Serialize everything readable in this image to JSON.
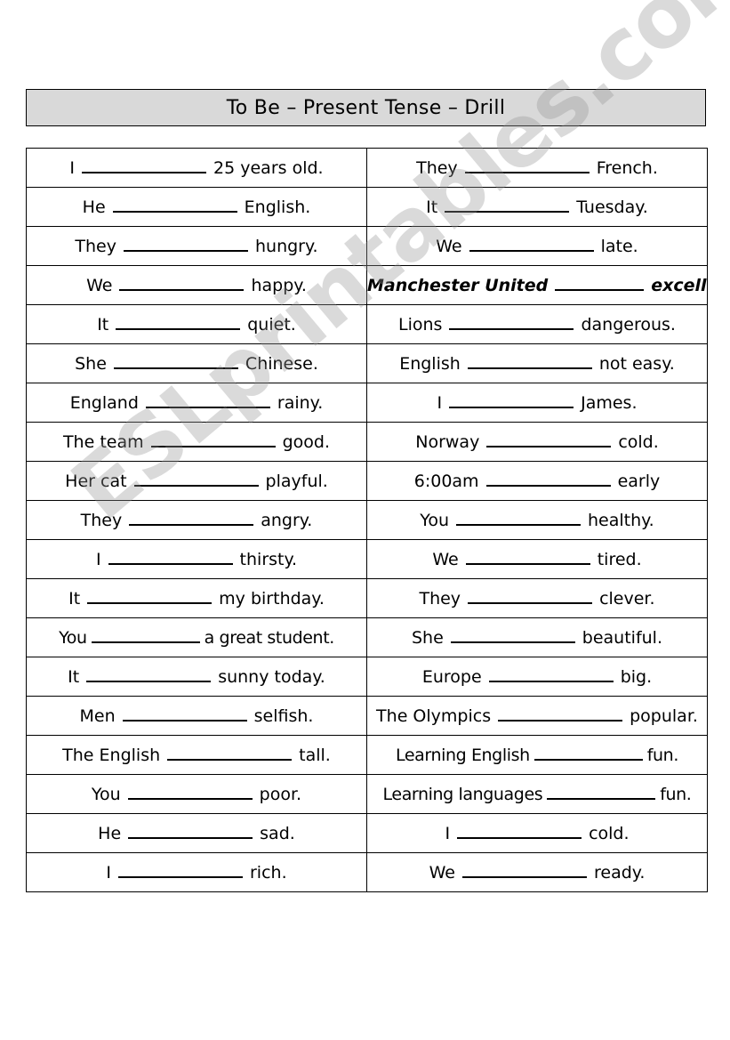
{
  "title": "To Be – Present Tense – Drill",
  "watermark": "ESLprintables.com",
  "rows": [
    {
      "left": {
        "subject": "I",
        "complement": "25 years old."
      },
      "right": {
        "subject": "They",
        "complement": "French."
      }
    },
    {
      "left": {
        "subject": "He",
        "complement": "English."
      },
      "right": {
        "subject": "It",
        "complement": "Tuesday."
      }
    },
    {
      "left": {
        "subject": "They",
        "complement": "hungry."
      },
      "right": {
        "subject": "We",
        "complement": "late."
      }
    },
    {
      "left": {
        "subject": "We",
        "complement": "happy."
      },
      "right": {
        "subject": "Manchester United",
        "complement": "excellent."
      }
    },
    {
      "left": {
        "subject": "It",
        "complement": "quiet."
      },
      "right": {
        "subject": "Lions",
        "complement": "dangerous."
      }
    },
    {
      "left": {
        "subject": "She",
        "complement": "Chinese."
      },
      "right": {
        "subject": "English",
        "complement": "not easy."
      }
    },
    {
      "left": {
        "subject": "England",
        "complement": "rainy."
      },
      "right": {
        "subject": "I",
        "complement": "James."
      }
    },
    {
      "left": {
        "subject": "The team",
        "complement": "good."
      },
      "right": {
        "subject": "Norway",
        "complement": "cold."
      }
    },
    {
      "left": {
        "subject": "Her cat",
        "complement": "playful."
      },
      "right": {
        "subject": "6:00am",
        "complement": "early"
      }
    },
    {
      "left": {
        "subject": "They",
        "complement": "angry."
      },
      "right": {
        "subject": "You",
        "complement": "healthy."
      }
    },
    {
      "left": {
        "subject": "I",
        "complement": "thirsty."
      },
      "right": {
        "subject": "We",
        "complement": "tired."
      }
    },
    {
      "left": {
        "subject": "It",
        "complement": "my birthday."
      },
      "right": {
        "subject": "They",
        "complement": "clever."
      }
    },
    {
      "left": {
        "subject": "You",
        "complement": "a great student."
      },
      "right": {
        "subject": "She",
        "complement": "beautiful."
      }
    },
    {
      "left": {
        "subject": "It",
        "complement": "sunny today."
      },
      "right": {
        "subject": "Europe",
        "complement": "big."
      }
    },
    {
      "left": {
        "subject": "Men",
        "complement": "selfish."
      },
      "right": {
        "subject": "The Olympics",
        "complement": "popular."
      }
    },
    {
      "left": {
        "subject": "The English",
        "complement": "tall."
      },
      "right": {
        "subject": "Learning English",
        "complement": "fun."
      }
    },
    {
      "left": {
        "subject": "You",
        "complement": "poor."
      },
      "right": {
        "subject": "Learning languages",
        "complement": "fun."
      }
    },
    {
      "left": {
        "subject": "He",
        "complement": "sad."
      },
      "right": {
        "subject": "I",
        "complement": "cold."
      }
    },
    {
      "left": {
        "subject": "I",
        "complement": "rich."
      },
      "right": {
        "subject": "We",
        "complement": "ready."
      }
    }
  ]
}
